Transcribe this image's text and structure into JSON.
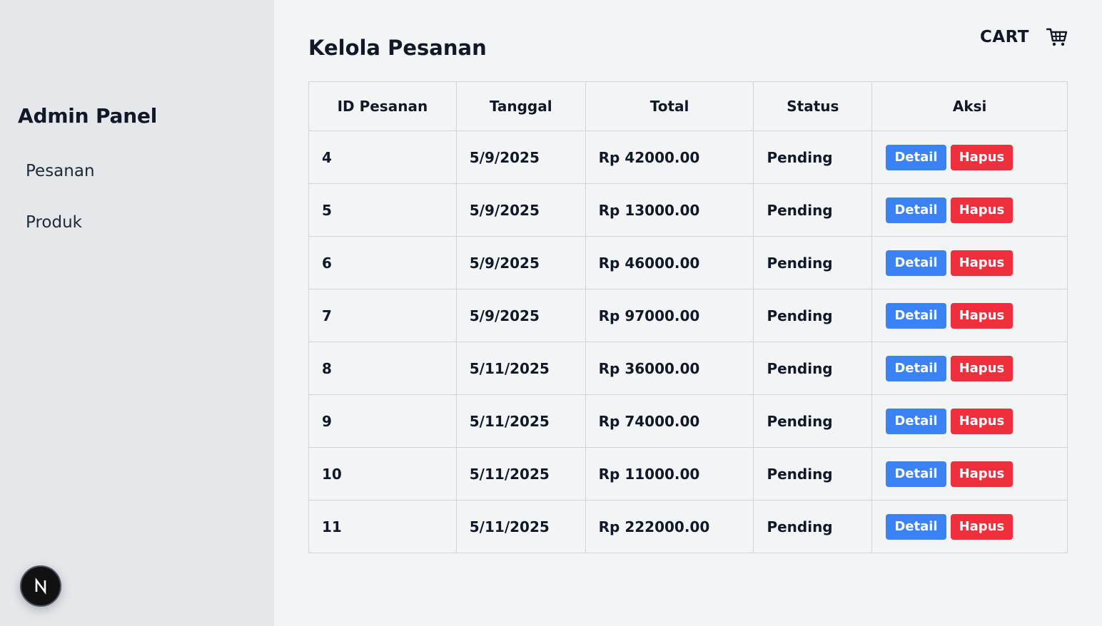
{
  "sidebar": {
    "title": "Admin Panel",
    "items": [
      {
        "label": "Pesanan"
      },
      {
        "label": "Produk"
      }
    ],
    "badge_letter": "N"
  },
  "header": {
    "page_title": "Kelola Pesanan",
    "cart_label": "CART",
    "cart_icon": "cart-icon"
  },
  "table": {
    "columns": [
      "ID Pesanan",
      "Tanggal",
      "Total",
      "Status",
      "Aksi"
    ],
    "rows": [
      {
        "id": "4",
        "date": "5/9/2025",
        "total": "Rp 42000.00",
        "status": "Pending"
      },
      {
        "id": "5",
        "date": "5/9/2025",
        "total": "Rp 13000.00",
        "status": "Pending"
      },
      {
        "id": "6",
        "date": "5/9/2025",
        "total": "Rp 46000.00",
        "status": "Pending"
      },
      {
        "id": "7",
        "date": "5/9/2025",
        "total": "Rp 97000.00",
        "status": "Pending"
      },
      {
        "id": "8",
        "date": "5/11/2025",
        "total": "Rp 36000.00",
        "status": "Pending"
      },
      {
        "id": "9",
        "date": "5/11/2025",
        "total": "Rp 74000.00",
        "status": "Pending"
      },
      {
        "id": "10",
        "date": "5/11/2025",
        "total": "Rp 11000.00",
        "status": "Pending"
      },
      {
        "id": "11",
        "date": "5/11/2025",
        "total": "Rp 222000.00",
        "status": "Pending"
      }
    ],
    "detail_label": "Detail",
    "delete_label": "Hapus"
  },
  "colors": {
    "sidebar_bg": "#e5e7eb",
    "page_bg": "#f3f4f6",
    "detail_button": "#3b82f6",
    "delete_button": "#ef2f3c"
  }
}
